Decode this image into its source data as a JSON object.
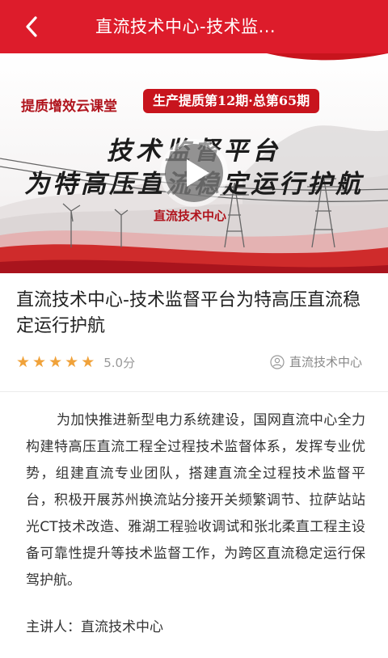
{
  "header": {
    "title": "直流技术中心-技术监...",
    "bg_color": "#dd1c2b"
  },
  "video": {
    "tag_left": "提质增效云课堂",
    "tag_right": "生产提质第12期·总第65期",
    "poster_line1": "技术监督平台",
    "poster_line2": "为特高压直流稳定运行护航",
    "poster_org": "直流技术中心"
  },
  "course": {
    "title": "直流技术中心-技术监督平台为特高压直流稳定运行护航",
    "rating_stars": 5,
    "rating_label": "5.0分",
    "author": "直流技术中心",
    "description": "为加快推进新型电力系统建设，国网直流中心全力构建特高压直流工程全过程技术监督体系，发挥专业优势，组建直流专业团队，搭建直流全过程技术监督平台，积极开展苏州换流站分接开关频繁调节、拉萨站站光CT技术改造、雅湖工程验收调试和张北柔直工程主设备可靠性提升等技术监督工作，为跨区直流稳定运行保驾护航。",
    "speaker": "主讲人：直流技术中心"
  },
  "colors": {
    "accent": "#dd1c2b",
    "star": "#f0a23a"
  }
}
